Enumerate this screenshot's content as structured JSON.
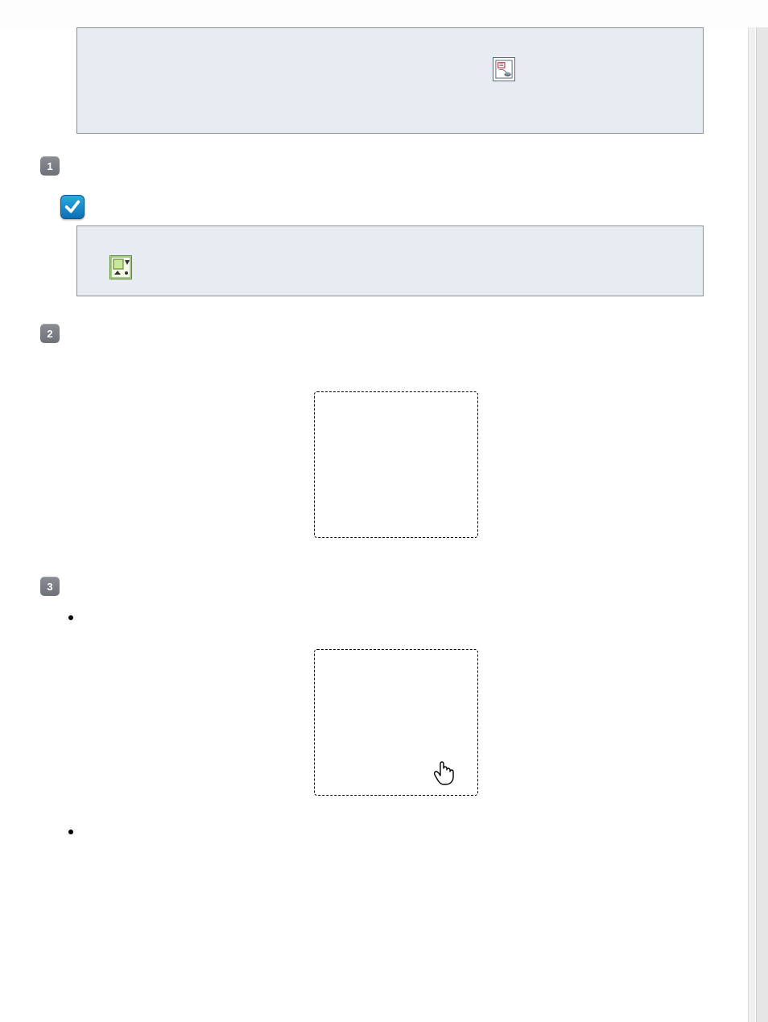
{
  "steps": {
    "badge1": "1",
    "badge2": "2",
    "badge3": "3"
  },
  "icons": {
    "scanner_icon": "scanner-icon",
    "check_icon": "check-icon",
    "image_tool_icon": "image-tool-icon",
    "hand_cursor_icon": "hand-cursor-icon"
  }
}
